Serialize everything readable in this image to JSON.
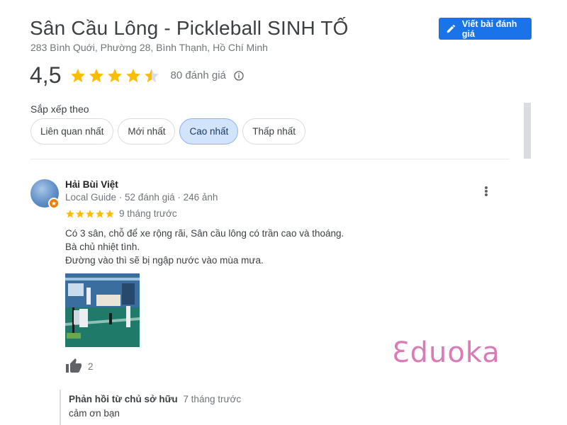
{
  "place": {
    "name": "Sân Cầu Lông - Pickleball SINH TỐ",
    "address": "283 Bình Quới, Phường 28, Bình Thạnh, Hồ Chí Minh"
  },
  "actions": {
    "write_review_label": "Viết bài đánh giá",
    "write_review_icon": "pencil-icon"
  },
  "rating": {
    "score_text": "4,5",
    "score_value": 4.5,
    "count_text": "80 đánh giá",
    "star_color": "#fbbc04",
    "empty_star_color": "#dadce0"
  },
  "sort": {
    "label": "Sắp xếp theo",
    "options": [
      "Liên quan nhất",
      "Mới nhất",
      "Cao nhất",
      "Thấp nhất"
    ],
    "selected": "Cao nhất"
  },
  "review": {
    "author": "Hải Bùi Việt",
    "meta": "Local Guide · 52 đánh giá · 246 ảnh",
    "stars": 5,
    "time": "9 tháng trước",
    "lines": [
      "Có 3 sân, chỗ để xe rộng rãi, Sân cầu lông có trần cao và thoáng.",
      "Bà chủ nhiệt tình.",
      "Đường vào thì sẽ bị ngập nước vào mùa mưa."
    ],
    "likes": "2",
    "owner_reply": {
      "label": "Phản hồi từ chủ sở hữu",
      "time": "7 tháng trước",
      "text": "cảm ơn bạn"
    }
  },
  "watermark": "Ɛduoka",
  "colors": {
    "accent": "#1a73e8",
    "chip_active_bg": "#d2e3fc",
    "watermark": "#dc7ab8"
  }
}
